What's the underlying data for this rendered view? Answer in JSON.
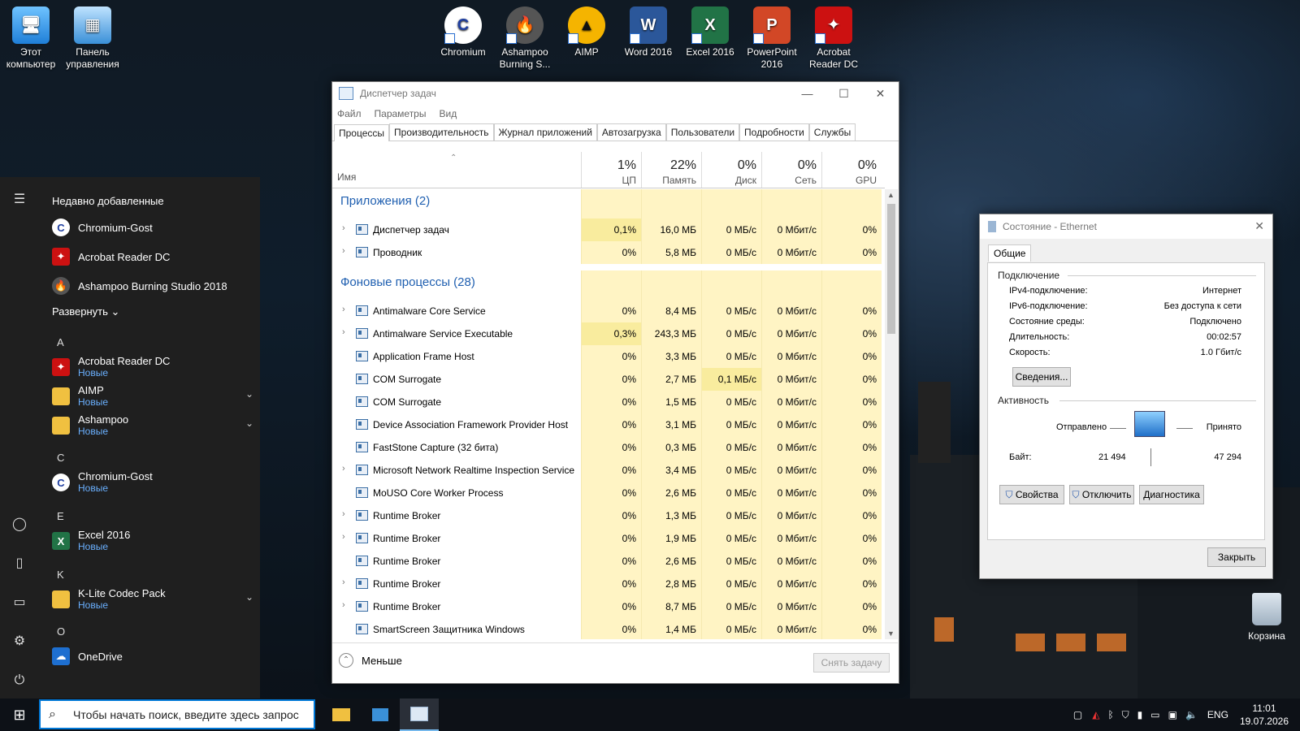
{
  "desktop": {
    "left_icons": [
      {
        "label": "Этот\nкомпьютер",
        "icon": "computer-icon"
      },
      {
        "label": "Панель\nуправления",
        "icon": "control-panel-icon"
      }
    ],
    "top_icons": [
      {
        "label": "Chromium",
        "icon": "chromium-icon",
        "color": "#ffffff"
      },
      {
        "label": "Ashampoo\nBurning S...",
        "icon": "ashampoo-icon",
        "color": "#555555"
      },
      {
        "label": "AIMP",
        "icon": "aimp-icon",
        "color": "#f5b400"
      },
      {
        "label": "Word 2016",
        "icon": "word-icon",
        "color": "#2b579a"
      },
      {
        "label": "Excel 2016",
        "icon": "excel-icon",
        "color": "#217346"
      },
      {
        "label": "PowerPoint\n2016",
        "icon": "powerpoint-icon",
        "color": "#d24726"
      },
      {
        "label": "Acrobat\nReader DC",
        "icon": "acrobat-icon",
        "color": "#cc1111"
      }
    ],
    "recycle_label": "Корзина"
  },
  "start_menu": {
    "recent_header": "Недавно добавленные",
    "recent": [
      {
        "label": "Chromium-Gost",
        "icon": "chromium-icon"
      },
      {
        "label": "Acrobat Reader DC",
        "icon": "acrobat-icon"
      },
      {
        "label": "Ashampoo Burning Studio 2018",
        "icon": "ashampoo-icon"
      }
    ],
    "expand_label": "Развернуть",
    "letters": [
      "A",
      "C",
      "E",
      "K",
      "O"
    ],
    "apps": [
      {
        "label": "Acrobat Reader DC",
        "badge": "Новые",
        "icon": "acrobat-icon"
      },
      {
        "label": "AIMP",
        "badge": "Новые",
        "icon": "folder-icon"
      },
      {
        "label": "Ashampoo",
        "badge": "Новые",
        "icon": "folder-icon"
      },
      {
        "label": "Chromium-Gost",
        "badge": "Новые",
        "icon": "chromium-icon"
      },
      {
        "label": "Excel 2016",
        "badge": "Новые",
        "icon": "excel-icon"
      },
      {
        "label": "K-Lite Codec Pack",
        "badge": "Новые",
        "icon": "folder-icon"
      },
      {
        "label": "OneDrive",
        "badge": "",
        "icon": "onedrive-icon"
      }
    ]
  },
  "taskbar": {
    "search_placeholder": "Чтобы начать поиск, введите здесь запрос",
    "lang": "ENG",
    "time": "11:01",
    "date": "19.07.2026"
  },
  "task_manager": {
    "title": "Диспетчер задач",
    "menu": [
      "Файл",
      "Параметры",
      "Вид"
    ],
    "tabs": [
      "Процессы",
      "Производительность",
      "Журнал приложений",
      "Автозагрузка",
      "Пользователи",
      "Подробности",
      "Службы"
    ],
    "col_name": "Имя",
    "columns": [
      {
        "pct": "1%",
        "label": "ЦП"
      },
      {
        "pct": "22%",
        "label": "Память"
      },
      {
        "pct": "0%",
        "label": "Диск"
      },
      {
        "pct": "0%",
        "label": "Сеть"
      },
      {
        "pct": "0%",
        "label": "GPU"
      }
    ],
    "group_apps": "Приложения (2)",
    "group_bg": "Фоновые процессы (28)",
    "apps": [
      {
        "name": "Диспетчер задач",
        "cpu": "0,1%",
        "mem": "16,0 МБ",
        "disk": "0 МБ/с",
        "net": "0 Мбит/с",
        "gpu": "0%",
        "expand": true
      },
      {
        "name": "Проводник",
        "cpu": "0%",
        "mem": "5,8 МБ",
        "disk": "0 МБ/с",
        "net": "0 Мбит/с",
        "gpu": "0%",
        "expand": true
      }
    ],
    "bg": [
      {
        "name": "Antimalware Core Service",
        "cpu": "0%",
        "mem": "8,4 МБ",
        "disk": "0 МБ/с",
        "net": "0 Мбит/с",
        "gpu": "0%",
        "expand": true
      },
      {
        "name": "Antimalware Service Executable",
        "cpu": "0,3%",
        "mem": "243,3 МБ",
        "disk": "0 МБ/с",
        "net": "0 Мбит/с",
        "gpu": "0%",
        "expand": true
      },
      {
        "name": "Application Frame Host",
        "cpu": "0%",
        "mem": "3,3 МБ",
        "disk": "0 МБ/с",
        "net": "0 Мбит/с",
        "gpu": "0%",
        "expand": false
      },
      {
        "name": "COM Surrogate",
        "cpu": "0%",
        "mem": "2,7 МБ",
        "disk": "0,1 МБ/с",
        "net": "0 Мбит/с",
        "gpu": "0%",
        "expand": false
      },
      {
        "name": "COM Surrogate",
        "cpu": "0%",
        "mem": "1,5 МБ",
        "disk": "0 МБ/с",
        "net": "0 Мбит/с",
        "gpu": "0%",
        "expand": false
      },
      {
        "name": "Device Association Framework Provider Host",
        "cpu": "0%",
        "mem": "3,1 МБ",
        "disk": "0 МБ/с",
        "net": "0 Мбит/с",
        "gpu": "0%",
        "expand": false
      },
      {
        "name": "FastStone Capture (32 бита)",
        "cpu": "0%",
        "mem": "0,3 МБ",
        "disk": "0 МБ/с",
        "net": "0 Мбит/с",
        "gpu": "0%",
        "expand": false
      },
      {
        "name": "Microsoft Network Realtime Inspection Service",
        "cpu": "0%",
        "mem": "3,4 МБ",
        "disk": "0 МБ/с",
        "net": "0 Мбит/с",
        "gpu": "0%",
        "expand": true
      },
      {
        "name": "MoUSO Core Worker Process",
        "cpu": "0%",
        "mem": "2,6 МБ",
        "disk": "0 МБ/с",
        "net": "0 Мбит/с",
        "gpu": "0%",
        "expand": false
      },
      {
        "name": "Runtime Broker",
        "cpu": "0%",
        "mem": "1,3 МБ",
        "disk": "0 МБ/с",
        "net": "0 Мбит/с",
        "gpu": "0%",
        "expand": true
      },
      {
        "name": "Runtime Broker",
        "cpu": "0%",
        "mem": "1,9 МБ",
        "disk": "0 МБ/с",
        "net": "0 Мбит/с",
        "gpu": "0%",
        "expand": true
      },
      {
        "name": "Runtime Broker",
        "cpu": "0%",
        "mem": "2,6 МБ",
        "disk": "0 МБ/с",
        "net": "0 Мбит/с",
        "gpu": "0%",
        "expand": false
      },
      {
        "name": "Runtime Broker",
        "cpu": "0%",
        "mem": "2,8 МБ",
        "disk": "0 МБ/с",
        "net": "0 Мбит/с",
        "gpu": "0%",
        "expand": true
      },
      {
        "name": "Runtime Broker",
        "cpu": "0%",
        "mem": "8,7 МБ",
        "disk": "0 МБ/с",
        "net": "0 Мбит/с",
        "gpu": "0%",
        "expand": true
      },
      {
        "name": "SmartScreen Защитника Windows",
        "cpu": "0%",
        "mem": "1,4 МБ",
        "disk": "0 МБ/с",
        "net": "0 Мбит/с",
        "gpu": "0%",
        "expand": false
      }
    ],
    "less_label": "Меньше",
    "end_task_label": "Снять задачу",
    "colors": {
      "cell_bg": "#fff4c4",
      "cell_hot": "#f9ec9e",
      "group": "#1f5fb0"
    }
  },
  "ethernet": {
    "title": "Состояние - Ethernet",
    "tab": "Общие",
    "conn_header": "Подключение",
    "fields": [
      {
        "k": "IPv4-подключение:",
        "v": "Интернет"
      },
      {
        "k": "IPv6-подключение:",
        "v": "Без доступа к сети"
      },
      {
        "k": "Состояние среды:",
        "v": "Подключено"
      },
      {
        "k": "Длительность:",
        "v": "00:02:57"
      },
      {
        "k": "Скорость:",
        "v": "1.0 Гбит/с"
      }
    ],
    "details_btn": "Сведения...",
    "activity_header": "Активность",
    "sent_label": "Отправлено",
    "recv_label": "Принято",
    "bytes_label": "Байт:",
    "bytes_sent": "21 494",
    "bytes_recv": "47 294",
    "props_btn": "Свойства",
    "disable_btn": "Отключить",
    "diag_btn": "Диагностика",
    "close_btn": "Закрыть"
  }
}
